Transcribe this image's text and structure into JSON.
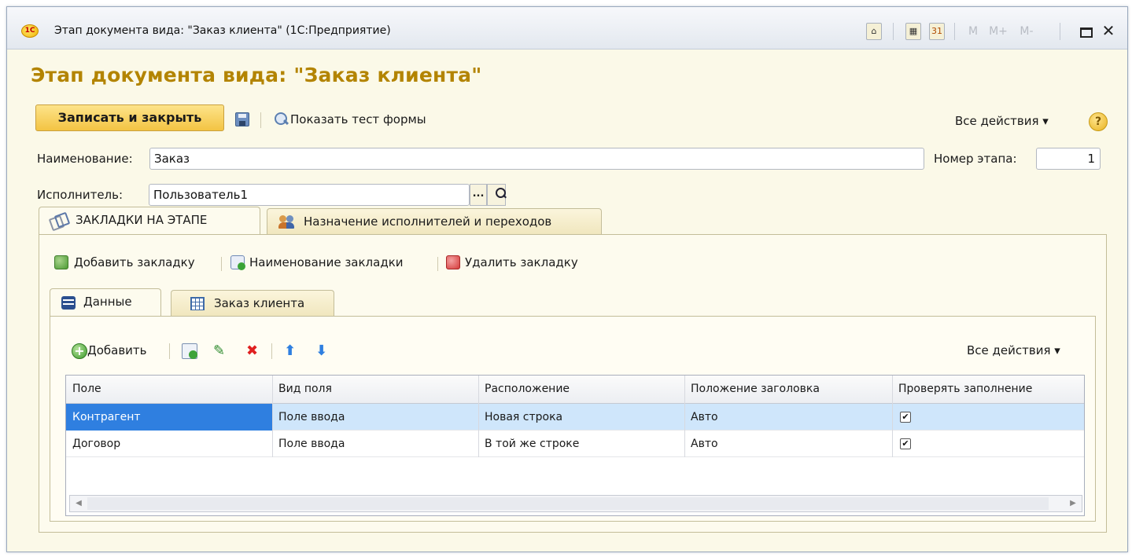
{
  "window": {
    "title": "Этап документа вида: \"Заказ клиента\"  (1С:Предприятие)",
    "app_icon": "1С",
    "toolbar": {
      "m_label": "M",
      "m_plus_label": "M+",
      "m_minus_label": "M-",
      "close_glyph": "✕"
    }
  },
  "form": {
    "title": "Этап документа вида: \"Заказ клиента\"",
    "commands": {
      "save_close": "Записать и закрыть",
      "show_test": "Показать тест формы",
      "all_actions": "Все действия",
      "help": "?"
    },
    "fields": {
      "name_label": "Наименование:",
      "name_value": "Заказ",
      "stage_number_label": "Номер этапа:",
      "stage_number_value": "1",
      "executor_label": "Исполнитель:",
      "executor_value": "Пользователь1",
      "choice_button": "...",
      "search_icon": "search-icon"
    },
    "outer_tabs": [
      {
        "label": "ЗАКЛАДКИ НА ЭТАПЕ",
        "icon": "bookmarks-icon",
        "active": true
      },
      {
        "label": "Назначение исполнителей и переходов",
        "icon": "users-icon",
        "active": false
      }
    ],
    "bookmark_commands": {
      "add": "Добавить закладку",
      "rename": "Наименование закладки",
      "delete": "Удалить закладку"
    },
    "inner_tabs": [
      {
        "label": "Данные",
        "icon": "database-icon",
        "active": true
      },
      {
        "label": "Заказ клиента",
        "icon": "table-icon",
        "active": false
      }
    ],
    "table_toolbar": {
      "add_label": "Добавить",
      "all_actions": "Все действия"
    },
    "table": {
      "columns": [
        "Поле",
        "Вид поля",
        "Расположение",
        "Положение заголовка",
        "Проверять заполнение"
      ],
      "rows": [
        {
          "field": "Контрагент",
          "kind": "Поле ввода",
          "placement": "Новая строка",
          "title_position": "Авто",
          "check": "✔",
          "selected": true
        },
        {
          "field": "Договор",
          "kind": "Поле ввода",
          "placement": "В той же строке",
          "title_position": "Авто",
          "check": "✔",
          "selected": false
        }
      ]
    },
    "colors": {
      "title_color": "#b38400",
      "primary_button": "#f3c443",
      "selection": "#2f7fe0",
      "selected_row": "#cfe6fb"
    }
  }
}
